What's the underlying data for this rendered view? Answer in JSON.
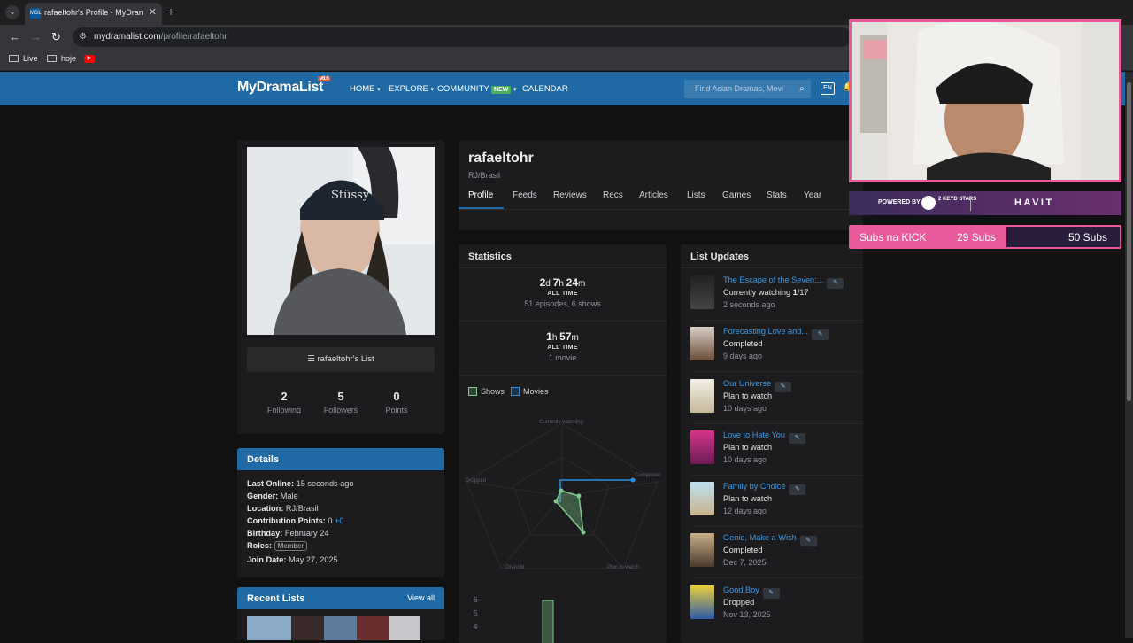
{
  "browser": {
    "tab_title": "rafaeltohr's Profile - MyDramaList",
    "url_host": "mydramalist.com",
    "url_path": "/profile/rafaeltohr",
    "bookmarks": [
      {
        "label": "Live"
      },
      {
        "label": "hoje"
      }
    ]
  },
  "site": {
    "logo": "MyDramaList",
    "version": "v6.6",
    "nav": [
      "HOME",
      "EXPLORE",
      "COMMUNITY",
      "CALENDAR"
    ],
    "new_badge": "NEW",
    "search_placeholder": "Find Asian Dramas, Movi",
    "lang": "EN"
  },
  "profile": {
    "username": "rafaeltohr",
    "location": "RJ/Brasil",
    "list_button": "rafaeltohr's List",
    "tabs": [
      "Profile",
      "Feeds",
      "Reviews",
      "Recs",
      "Articles",
      "Lists",
      "Games",
      "Stats",
      "Year"
    ],
    "counts": [
      {
        "value": "2",
        "label": "Following"
      },
      {
        "value": "5",
        "label": "Followers"
      },
      {
        "value": "0",
        "label": "Points"
      }
    ]
  },
  "details": {
    "title": "Details",
    "rows": [
      {
        "key": "Last Online:",
        "value": "15 seconds ago"
      },
      {
        "key": "Gender:",
        "value": "Male"
      },
      {
        "key": "Location:",
        "value": "RJ/Brasil"
      },
      {
        "key": "Contribution Points:",
        "value": "0"
      },
      {
        "key": "Birthday:",
        "value": "February 24"
      },
      {
        "key": "Roles:",
        "value": "Member"
      },
      {
        "key": "Join Date:",
        "value": "May 27, 2025"
      }
    ],
    "contrib_extra": "+0"
  },
  "recent_lists": {
    "title": "Recent Lists",
    "view_all": "View all"
  },
  "statistics": {
    "title": "Statistics",
    "shows": {
      "d": "2",
      "h": "7",
      "m": "24",
      "all_time": "ALL TIME",
      "sub": "51 episodes, 6 shows"
    },
    "movies": {
      "h": "1",
      "m": "57",
      "all_time": "ALL TIME",
      "sub": "1 movie"
    },
    "legend": [
      "Shows",
      "Movies"
    ],
    "radar_labels": [
      "Currently watching",
      "Completed",
      "Plan to watch",
      "On-hold",
      "Dropped"
    ],
    "bar_ticks": [
      "6",
      "5",
      "4"
    ]
  },
  "list_updates": {
    "title": "List Updates",
    "items": [
      {
        "name": "The Escape of the Seven:...",
        "status_pre": "Currently watching ",
        "status_bold": "1",
        "status_post": "/17",
        "when": "2 seconds ago"
      },
      {
        "name": "Forecasting Love and...",
        "status_pre": "Completed",
        "status_bold": "",
        "status_post": "",
        "when": "9 days ago"
      },
      {
        "name": "Our Universe",
        "status_pre": "Plan to watch",
        "status_bold": "",
        "status_post": "",
        "when": "10 days ago"
      },
      {
        "name": "Love to Hate You",
        "status_pre": "Plan to watch",
        "status_bold": "",
        "status_post": "",
        "when": "10 days ago"
      },
      {
        "name": "Family by Choice",
        "status_pre": "Plan to watch",
        "status_bold": "",
        "status_post": "",
        "when": "12 days ago"
      },
      {
        "name": "Genie, Make a Wish",
        "status_pre": "Completed",
        "status_bold": "",
        "status_post": "",
        "when": "Dec 7, 2025"
      },
      {
        "name": "Good Boy",
        "status_pre": "Dropped",
        "status_bold": "",
        "status_post": "",
        "when": "Nov 13, 2025"
      }
    ]
  },
  "overlay": {
    "powered_by": "POWERED BY",
    "keyd": "2 KEYD STARS",
    "havit": "HAVIT",
    "subs_label": "Subs na KICK",
    "subs_current": "29 Subs",
    "subs_goal": "50 Subs",
    "subs_progress": 0.58
  },
  "colors": {
    "accent": "#1f69a5",
    "link": "#3c9be4",
    "shows": "#7fc98a",
    "movies": "#2d8fe0",
    "overlay_pink": "#e95a9b"
  }
}
